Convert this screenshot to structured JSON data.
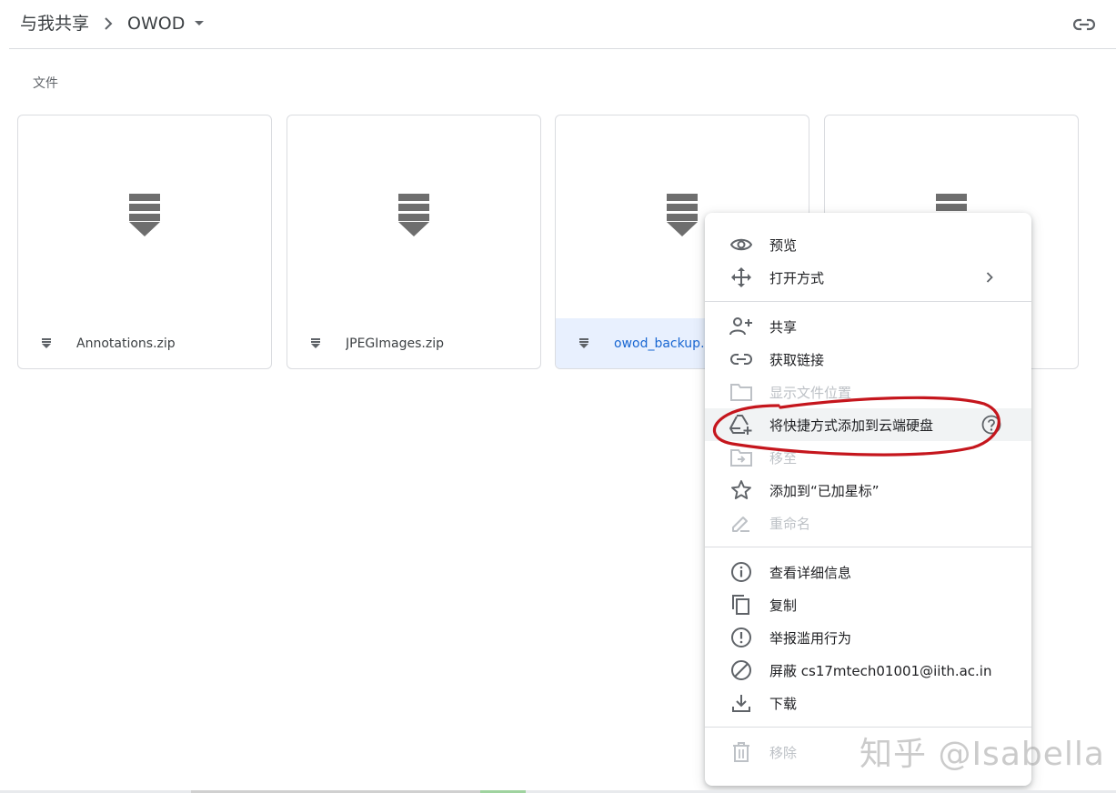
{
  "breadcrumb": {
    "parent": "与我共享",
    "current": "OWOD"
  },
  "section": {
    "files_label": "文件"
  },
  "files": [
    {
      "name": "Annotations.zip",
      "icon": "zip-icon"
    },
    {
      "name": "JPEGImages.zip",
      "icon": "zip-icon"
    },
    {
      "name": "owod_backup.zip",
      "icon": "zip-icon",
      "selected": true
    },
    {
      "name": "",
      "icon": "zip-icon"
    }
  ],
  "menu": {
    "items": [
      {
        "label": "预览",
        "icon": "eye-icon"
      },
      {
        "label": "打开方式",
        "icon": "move-arrows-icon",
        "trailing": "chevron-right-icon"
      },
      {
        "label": "共享",
        "icon": "add-person-icon"
      },
      {
        "label": "获取链接",
        "icon": "link-icon"
      },
      {
        "label": "显示文件位置",
        "icon": "folder-icon",
        "disabled": true
      },
      {
        "label": "将快捷方式添加到云端硬盘",
        "icon": "drive-add-icon",
        "trailing": "help-icon",
        "highlighted": true
      },
      {
        "label": "移至",
        "icon": "move-to-folder-icon",
        "disabled": true
      },
      {
        "label": "添加到“已加星标”",
        "icon": "star-icon"
      },
      {
        "label": "重命名",
        "icon": "pencil-icon",
        "disabled": true
      },
      {
        "label": "查看详细信息",
        "icon": "info-icon"
      },
      {
        "label": "复制",
        "icon": "copy-icon"
      },
      {
        "label": "举报滥用行为",
        "icon": "report-icon"
      },
      {
        "label": "屏蔽 cs17mtech01001@iith.ac.in",
        "icon": "block-icon"
      },
      {
        "label": "下载",
        "icon": "download-icon"
      },
      {
        "label": "移除",
        "icon": "trash-icon",
        "disabled": true
      }
    ]
  },
  "watermark": "知乎 @Isabella",
  "colors": {
    "selected_bg": "#e8f0fe",
    "selected_text": "#1967d2",
    "icon_grey": "#5f6368",
    "disabled": "#bdc1c6",
    "annotation_red": "#c5161d"
  }
}
